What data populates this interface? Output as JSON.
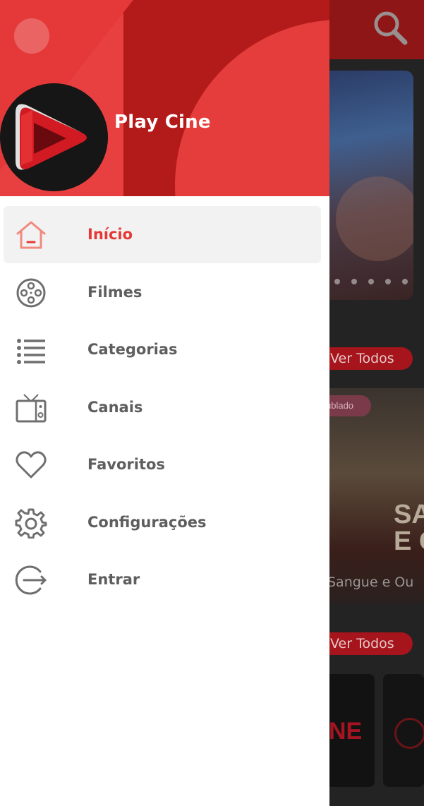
{
  "background": {
    "ver_todos_1": "Ver Todos",
    "ver_todos_2": "Ver Todos",
    "poster_badge": "ublado",
    "poster_title_art_line1": "SANG",
    "poster_title_art_line2": "E OU",
    "poster_caption": "Sangue e Ou",
    "card_logo_text": "NE"
  },
  "drawer": {
    "app_name": "Play Cine",
    "items": [
      {
        "label": "Início",
        "icon": "home-icon",
        "active": true
      },
      {
        "label": "Filmes",
        "icon": "film-reel-icon",
        "active": false
      },
      {
        "label": "Categorias",
        "icon": "list-icon",
        "active": false
      },
      {
        "label": "Canais",
        "icon": "tv-icon",
        "active": false
      },
      {
        "label": "Favoritos",
        "icon": "heart-icon",
        "active": false
      },
      {
        "label": "Configurações",
        "icon": "gear-icon",
        "active": false
      },
      {
        "label": "Entrar",
        "icon": "login-icon",
        "active": false
      }
    ]
  },
  "colors": {
    "accent": "#e53935",
    "header_red": "#b31b1b",
    "icon_gray": "#6f6f6f",
    "text_gray": "#5e5e5e"
  }
}
